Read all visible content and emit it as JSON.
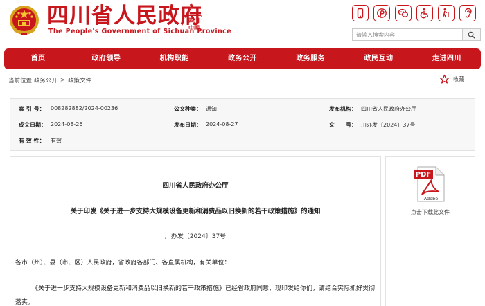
{
  "header": {
    "title": "四川省人民政府",
    "subtitle": "The People's Government of Sichuan Province",
    "seal_text": "四川\n中国",
    "search_placeholder": "请输入搜索内容"
  },
  "tools": [
    "phone-icon",
    "pinterest-icon",
    "wechat-icon",
    "accessibility-icon",
    "elderly-icon",
    "ear-icon"
  ],
  "nav": [
    "首页",
    "政府领导",
    "机构职能",
    "政务公开",
    "政务服务",
    "政民互动",
    "走进四川"
  ],
  "breadcrumb": {
    "prefix": "当前位置:",
    "items": [
      "政务公开",
      "政策文件"
    ],
    "sep": ">"
  },
  "favorite_label": "收藏",
  "info": {
    "index_label": "索 引 号：",
    "index_value": "008282882/2024-00236",
    "type_label": "公文种类：",
    "type_value": "通知",
    "org_label": "发布机构：",
    "org_value": "四川省人民政府办公厅",
    "created_label": "成文日期：",
    "created_value": "2024-08-26",
    "published_label": "发布日期：",
    "published_value": "2024-08-27",
    "docno_label": "文　　号：",
    "docno_value": "川办发〔2024〕37号",
    "validity_label": "有 效 性：",
    "validity_value": "有效"
  },
  "article": {
    "issuer": "四川省人民政府办公厅",
    "title": "关于印发《关于进一步支持大规模设备更新和消费品以旧换新的若干政策措施》的通知",
    "doc_no": "川办发〔2024〕37号",
    "para1": "各市（州）、县（市、区）人民政府，省政府各部门、各直属机构，有关单位：",
    "para2": "《关于进一步支持大规模设备更新和消费品以旧换新的若干政策措施》已经省政府同意，现印发给你们，请结合实际抓好贯彻落实。"
  },
  "side": {
    "pdf_text": "PDF",
    "adobe_text": "Adobe",
    "download_label": "点击下载此文件"
  },
  "colors": {
    "brand_red": "#c8161d",
    "info_bg": "#f7f7f7"
  }
}
